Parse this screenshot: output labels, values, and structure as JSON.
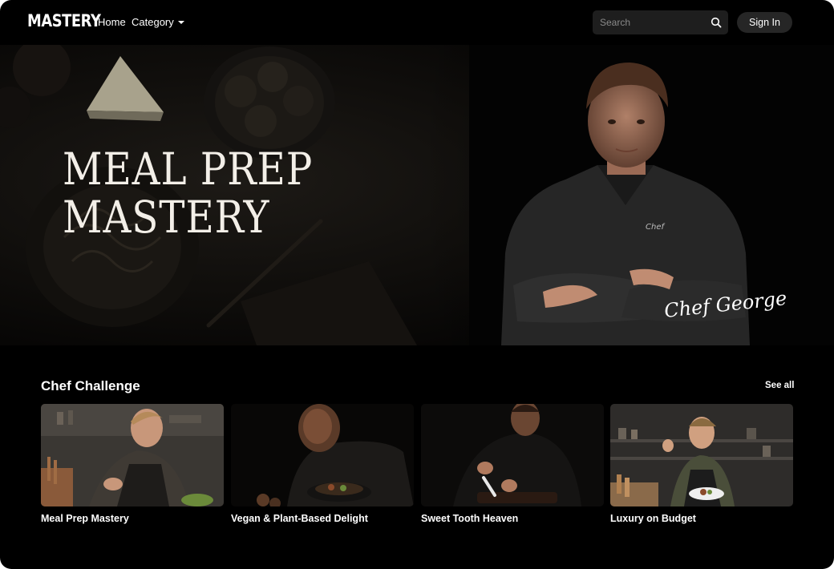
{
  "nav": {
    "logo": "MASTERY",
    "home_label": "Home",
    "category_label": "Category",
    "search_placeholder": "Search",
    "signin_label": "Sign In"
  },
  "hero": {
    "title_line1": "MEAL PREP",
    "title_line2": "MASTERY",
    "chef_name": "Chef George",
    "jacket_label": "Chef"
  },
  "section": {
    "title": "Chef Challenge",
    "see_all_label": "See all",
    "cards": [
      {
        "title": "Meal Prep Mastery"
      },
      {
        "title": "Vegan & Plant-Based Delight"
      },
      {
        "title": "Sweet Tooth Heaven"
      },
      {
        "title": "Luxury on Budget"
      }
    ]
  },
  "colors": {
    "background": "#000000",
    "search_bg": "#1e1e1e",
    "button_bg": "#262626",
    "text": "#ffffff"
  }
}
